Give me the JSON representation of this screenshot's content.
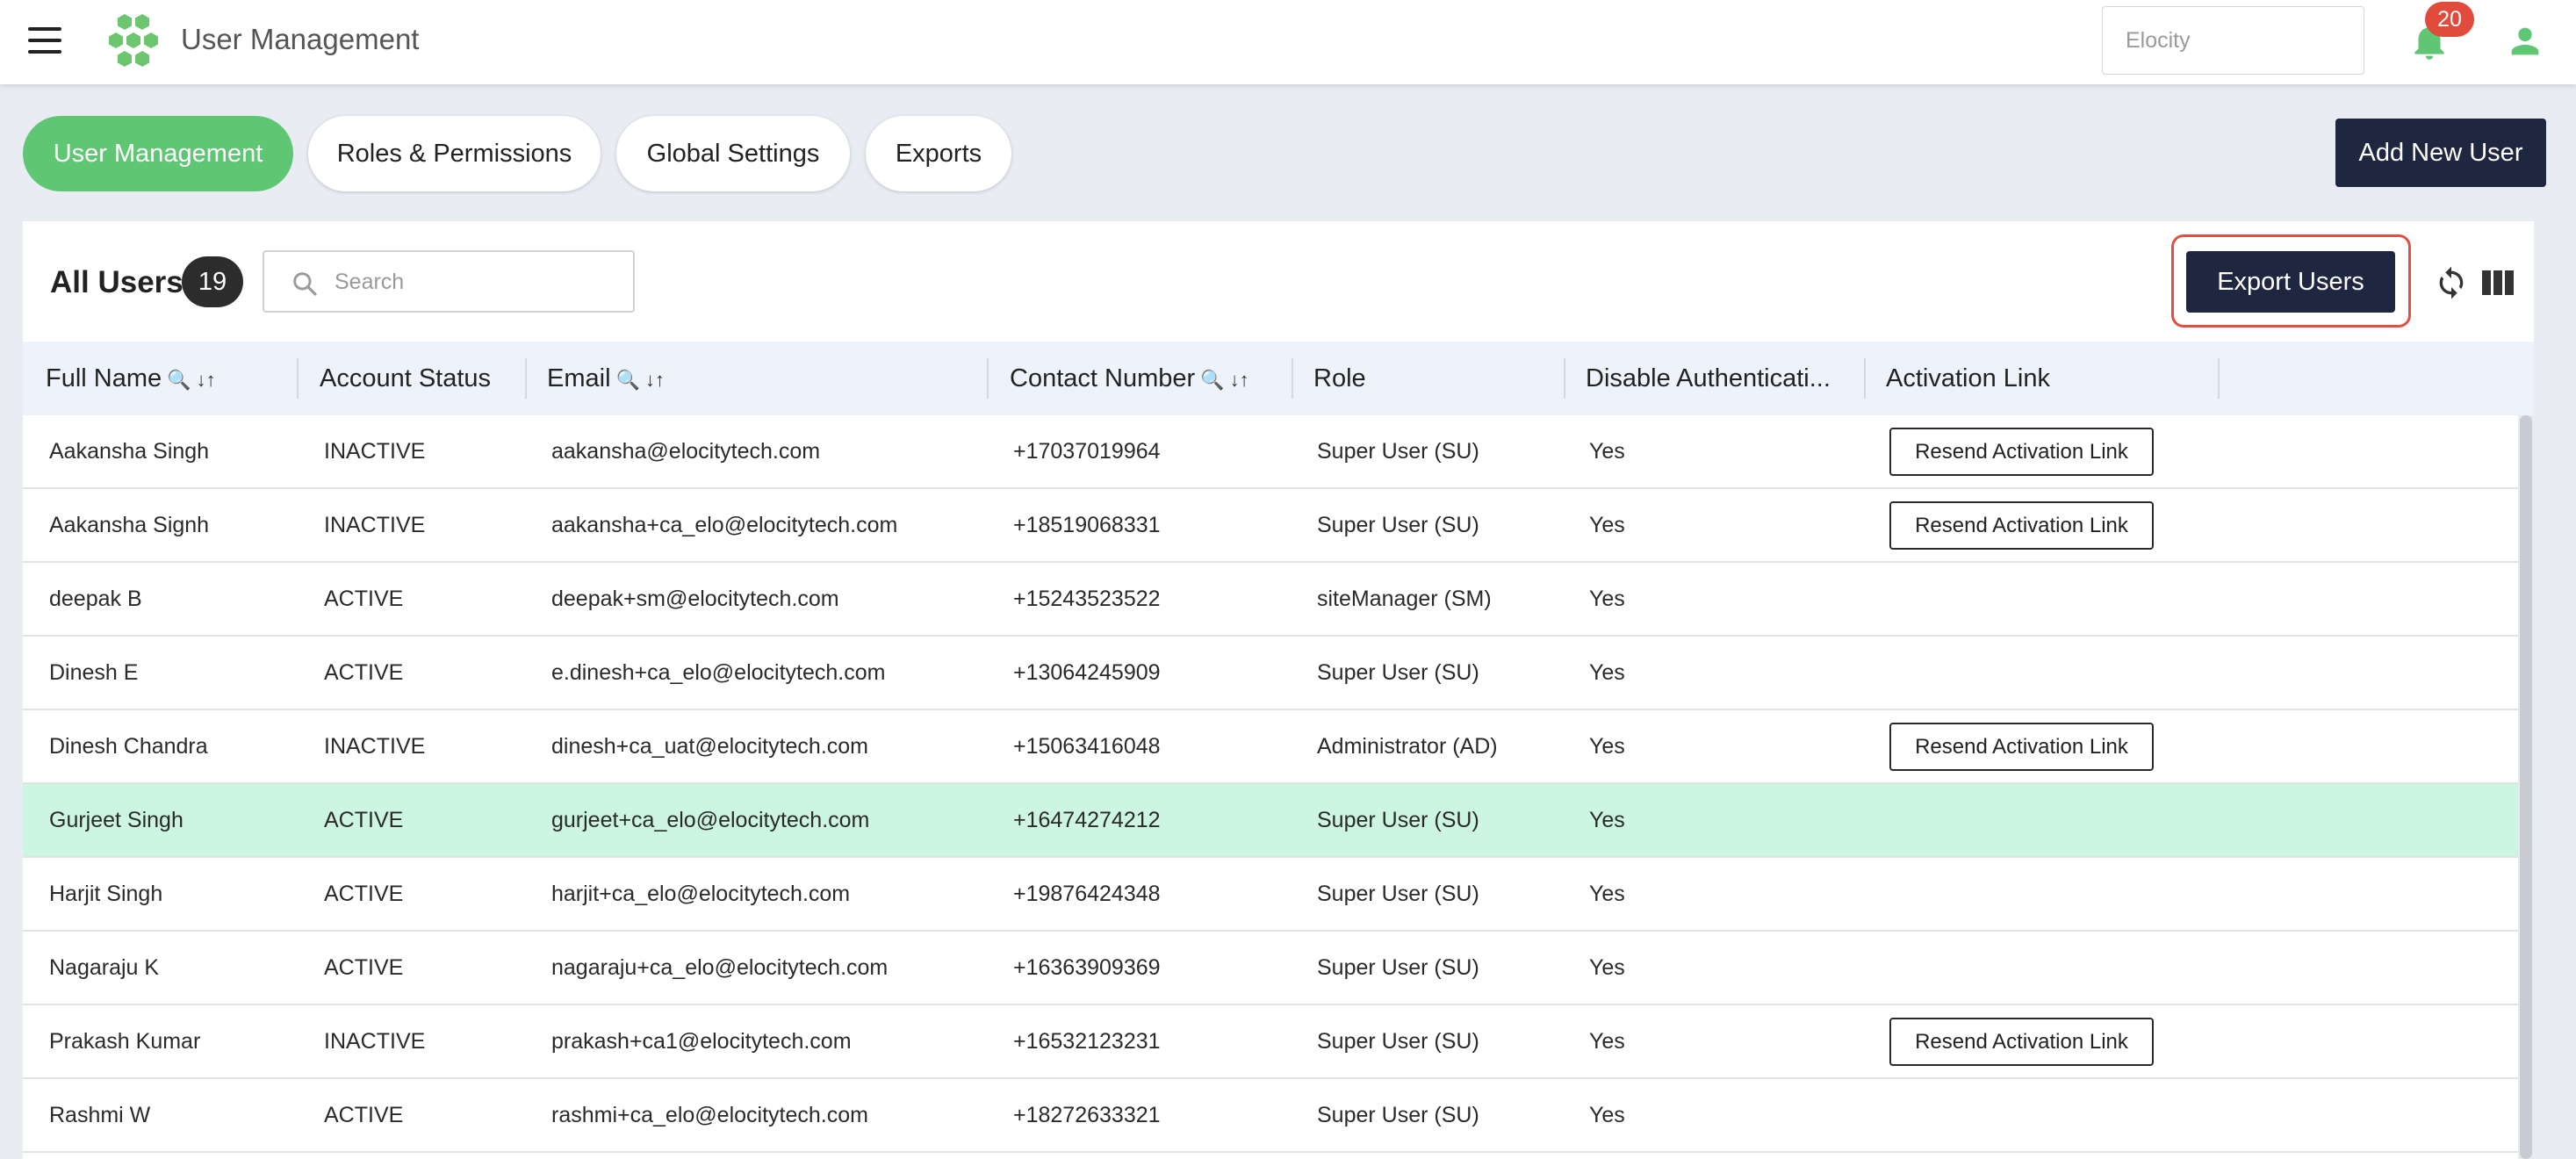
{
  "app": {
    "title": "User Management",
    "tenant_placeholder": "Elocity",
    "notification_count": "20"
  },
  "tabs": [
    {
      "label": "User Management",
      "active": true
    },
    {
      "label": "Roles & Permissions",
      "active": false
    },
    {
      "label": "Global Settings",
      "active": false
    },
    {
      "label": "Exports",
      "active": false
    }
  ],
  "actions": {
    "add_user": "Add New User",
    "export_users": "Export Users"
  },
  "users_panel": {
    "title": "All Users",
    "count": "19",
    "search_placeholder": "Search"
  },
  "table": {
    "columns": [
      {
        "label": "Full Name",
        "icons": "🔍 ↓↑"
      },
      {
        "label": "Account Status",
        "icons": ""
      },
      {
        "label": "Email",
        "icons": "🔍 ↓↑"
      },
      {
        "label": "Contact Number",
        "icons": "🔍 ↓↑"
      },
      {
        "label": "Role",
        "icons": ""
      },
      {
        "label": "Disable Authenticati...",
        "icons": ""
      },
      {
        "label": "Activation Link",
        "icons": ""
      }
    ],
    "resend_label": "Resend Activation Link",
    "rows": [
      {
        "name": "Aakansha Singh",
        "status": "INACTIVE",
        "email": "aakansha@elocitytech.com",
        "phone": "+17037019964",
        "role": "Super User (SU)",
        "disable_auth": "Yes",
        "has_resend": true,
        "selected": false
      },
      {
        "name": "Aakansha Signh",
        "status": "INACTIVE",
        "email": "aakansha+ca_elo@elocitytech.com",
        "phone": "+18519068331",
        "role": "Super User (SU)",
        "disable_auth": "Yes",
        "has_resend": true,
        "selected": false
      },
      {
        "name": "deepak B",
        "status": "ACTIVE",
        "email": "deepak+sm@elocitytech.com",
        "phone": "+15243523522",
        "role": "siteManager (SM)",
        "disable_auth": "Yes",
        "has_resend": false,
        "selected": false
      },
      {
        "name": "Dinesh E",
        "status": "ACTIVE",
        "email": "e.dinesh+ca_elo@elocitytech.com",
        "phone": "+13064245909",
        "role": "Super User (SU)",
        "disable_auth": "Yes",
        "has_resend": false,
        "selected": false
      },
      {
        "name": "Dinesh Chandra",
        "status": "INACTIVE",
        "email": "dinesh+ca_uat@elocitytech.com",
        "phone": "+15063416048",
        "role": "Administrator (AD)",
        "disable_auth": "Yes",
        "has_resend": true,
        "selected": false
      },
      {
        "name": "Gurjeet Singh",
        "status": "ACTIVE",
        "email": "gurjeet+ca_elo@elocitytech.com",
        "phone": "+16474274212",
        "role": "Super User (SU)",
        "disable_auth": "Yes",
        "has_resend": false,
        "selected": true
      },
      {
        "name": "Harjit Singh",
        "status": "ACTIVE",
        "email": "harjit+ca_elo@elocitytech.com",
        "phone": "+19876424348",
        "role": "Super User (SU)",
        "disable_auth": "Yes",
        "has_resend": false,
        "selected": false
      },
      {
        "name": "Nagaraju K",
        "status": "ACTIVE",
        "email": "nagaraju+ca_elo@elocitytech.com",
        "phone": "+16363909369",
        "role": "Super User (SU)",
        "disable_auth": "Yes",
        "has_resend": false,
        "selected": false
      },
      {
        "name": "Prakash Kumar",
        "status": "INACTIVE",
        "email": "prakash+ca1@elocitytech.com",
        "phone": "+16532123231",
        "role": "Super User (SU)",
        "disable_auth": "Yes",
        "has_resend": true,
        "selected": false
      },
      {
        "name": "Rashmi W",
        "status": "ACTIVE",
        "email": "rashmi+ca_elo@elocitytech.com",
        "phone": "+18272633321",
        "role": "Super User (SU)",
        "disable_auth": "Yes",
        "has_resend": false,
        "selected": false
      }
    ]
  },
  "icons": [
    "menu-icon",
    "logo-icon",
    "bell-icon",
    "user-icon",
    "search-icon",
    "refresh-icon",
    "columns-icon"
  ],
  "colors": {
    "accent_green": "#5fc774",
    "dark_button": "#1e2640",
    "badge_red": "#e04b3c",
    "selected_row": "#ccf5e2",
    "highlight_outline": "#e0513f"
  }
}
